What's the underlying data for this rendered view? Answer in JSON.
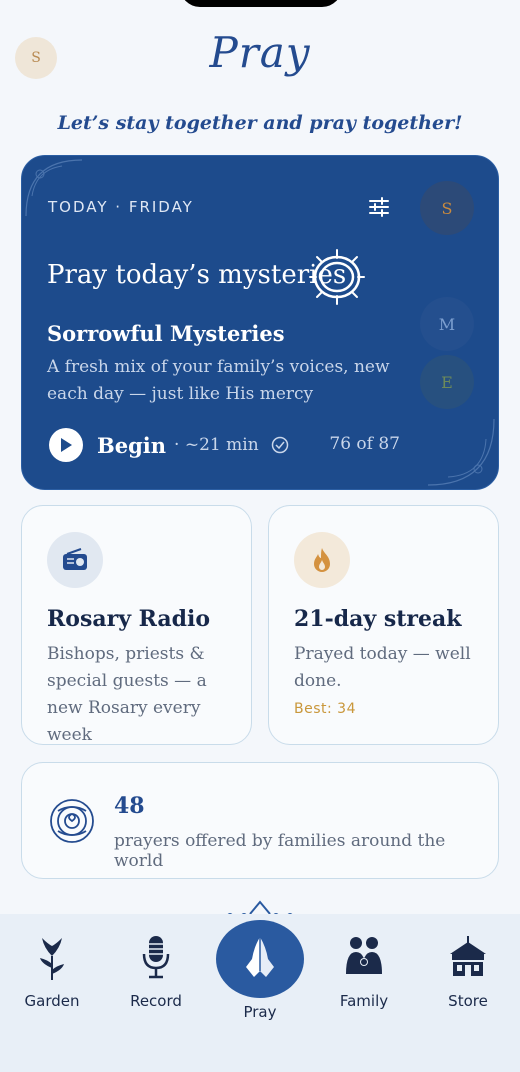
{
  "header": {
    "avatar_initial": "S",
    "title": "Pray",
    "tagline": "Let’s stay together and pray together!"
  },
  "hero": {
    "day_label": "TODAY · FRIDAY",
    "title": "Pray today’s mysteries",
    "mystery": "Sorrowful Mysteries",
    "description": "A fresh mix of your family’s voices, new each day — just like His mercy",
    "begin_label": "Begin",
    "duration": "· ~21 min",
    "count": "76 of 87",
    "avatars": [
      "S",
      "M",
      "E"
    ],
    "icons": [
      "settings-sliders-icon",
      "crown-of-thorns-icon",
      "play-icon",
      "check-circle-icon"
    ]
  },
  "radio_card": {
    "title": "Rosary Radio",
    "description": "Bishops, priests & special guests — a new Rosary every week",
    "icon": "radio-icon"
  },
  "streak_card": {
    "title": "21-day streak",
    "description": "Prayed today — well done.",
    "best": "Best: 34",
    "icon": "flame-icon"
  },
  "prayers_card": {
    "count": "48",
    "label": "prayers offered by families around the world",
    "icon": "rose-icon"
  },
  "tabbar": {
    "tabs": [
      {
        "label": "Garden",
        "icon": "lily-icon"
      },
      {
        "label": "Record",
        "icon": "microphone-icon"
      },
      {
        "label": "Pray",
        "icon": "praying-hands-icon"
      },
      {
        "label": "Family",
        "icon": "family-icon"
      },
      {
        "label": "Store",
        "icon": "store-icon"
      }
    ]
  },
  "colors": {
    "primary": "#1d4b8c",
    "accent_gold": "#c9973b",
    "background": "#f4f7fb"
  }
}
